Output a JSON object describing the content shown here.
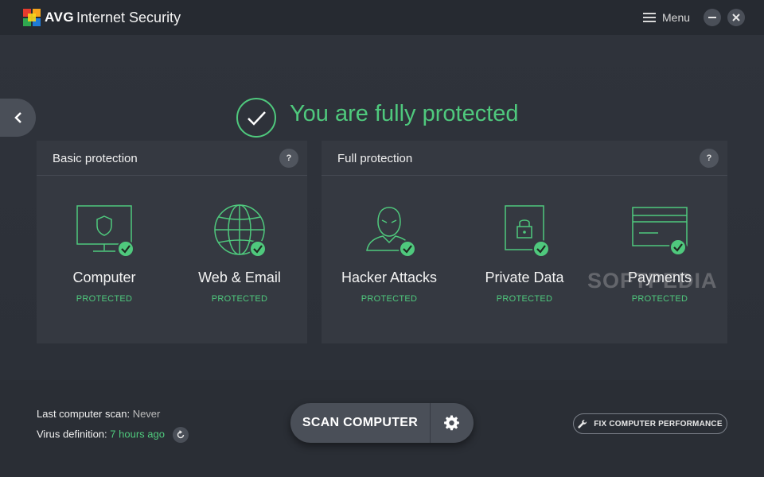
{
  "app": {
    "brand": "AVG",
    "product": "Internet Security",
    "menu_label": "Menu"
  },
  "status": {
    "message": "You are fully protected"
  },
  "basic_panel": {
    "title": "Basic protection",
    "help": "?",
    "items": [
      {
        "label": "Computer",
        "status": "PROTECTED",
        "icon": "monitor-shield-icon"
      },
      {
        "label": "Web & Email",
        "status": "PROTECTED",
        "icon": "globe-icon"
      }
    ]
  },
  "full_panel": {
    "title": "Full protection",
    "help": "?",
    "items": [
      {
        "label": "Hacker Attacks",
        "status": "PROTECTED",
        "icon": "hacker-icon"
      },
      {
        "label": "Private Data",
        "status": "PROTECTED",
        "icon": "locked-document-icon"
      },
      {
        "label": "Payments",
        "status": "PROTECTED",
        "icon": "credit-card-icon"
      }
    ]
  },
  "footer": {
    "last_scan_label": "Last computer scan:",
    "last_scan_value": "Never",
    "virus_def_label": "Virus definition:",
    "virus_def_value": "7 hours ago",
    "scan_button": "SCAN COMPUTER",
    "fix_button": "FIX COMPUTER PERFORMANCE"
  },
  "watermark": "SOFTPEDIA",
  "colors": {
    "accent": "#4fc97d",
    "background": "#2b2f37",
    "panel": "#353941"
  }
}
